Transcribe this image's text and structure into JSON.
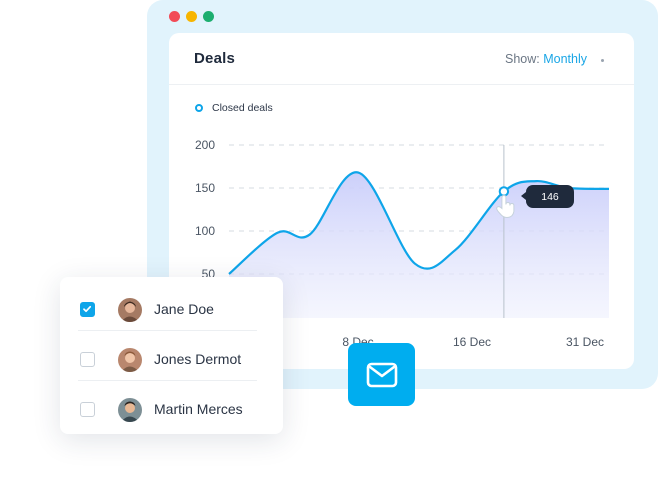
{
  "window": {
    "controls": [
      "close",
      "minimize",
      "maximize"
    ],
    "colors": {
      "close": "#f24b57",
      "minimize": "#f7b500",
      "maximize": "#1cae6f"
    }
  },
  "card": {
    "title": "Deals",
    "show_label": "Show:",
    "show_value": "Monthly"
  },
  "chart_data": {
    "type": "area",
    "legend": [
      "Closed deals"
    ],
    "y_ticks": [
      "200",
      "150",
      "100",
      "50"
    ],
    "x_ticks": [
      "8 Dec",
      "16 Dec",
      "31 Dec"
    ],
    "ylim": [
      0,
      200
    ],
    "grid": true,
    "series": [
      {
        "name": "Closed deals",
        "color": "#0ea5e9",
        "points": [
          {
            "x": 0.0,
            "y": 50
          },
          {
            "x": 3.0,
            "y": 98
          },
          {
            "x": 5.0,
            "y": 96
          },
          {
            "x": 8.0,
            "y": 168
          },
          {
            "x": 11.5,
            "y": 62
          },
          {
            "x": 14.0,
            "y": 78
          },
          {
            "x": 17.0,
            "y": 146
          },
          {
            "x": 19.0,
            "y": 158
          },
          {
            "x": 21.0,
            "y": 150
          },
          {
            "x": 23.5,
            "y": 149
          }
        ]
      }
    ],
    "highlight": {
      "x": 17.0,
      "y": 146,
      "label": "146"
    }
  },
  "checklist": {
    "items": [
      {
        "name": "Jane Doe",
        "checked": true
      },
      {
        "name": "Jones Dermot",
        "checked": false
      },
      {
        "name": "Martin Merces",
        "checked": false
      }
    ]
  },
  "mail_button": {
    "icon": "mail-icon",
    "color": "#00adef"
  },
  "colors": {
    "accent": "#0ea5e9",
    "tooltip_bg": "#1f2a3c",
    "window_bg": "#e1f3fc"
  }
}
